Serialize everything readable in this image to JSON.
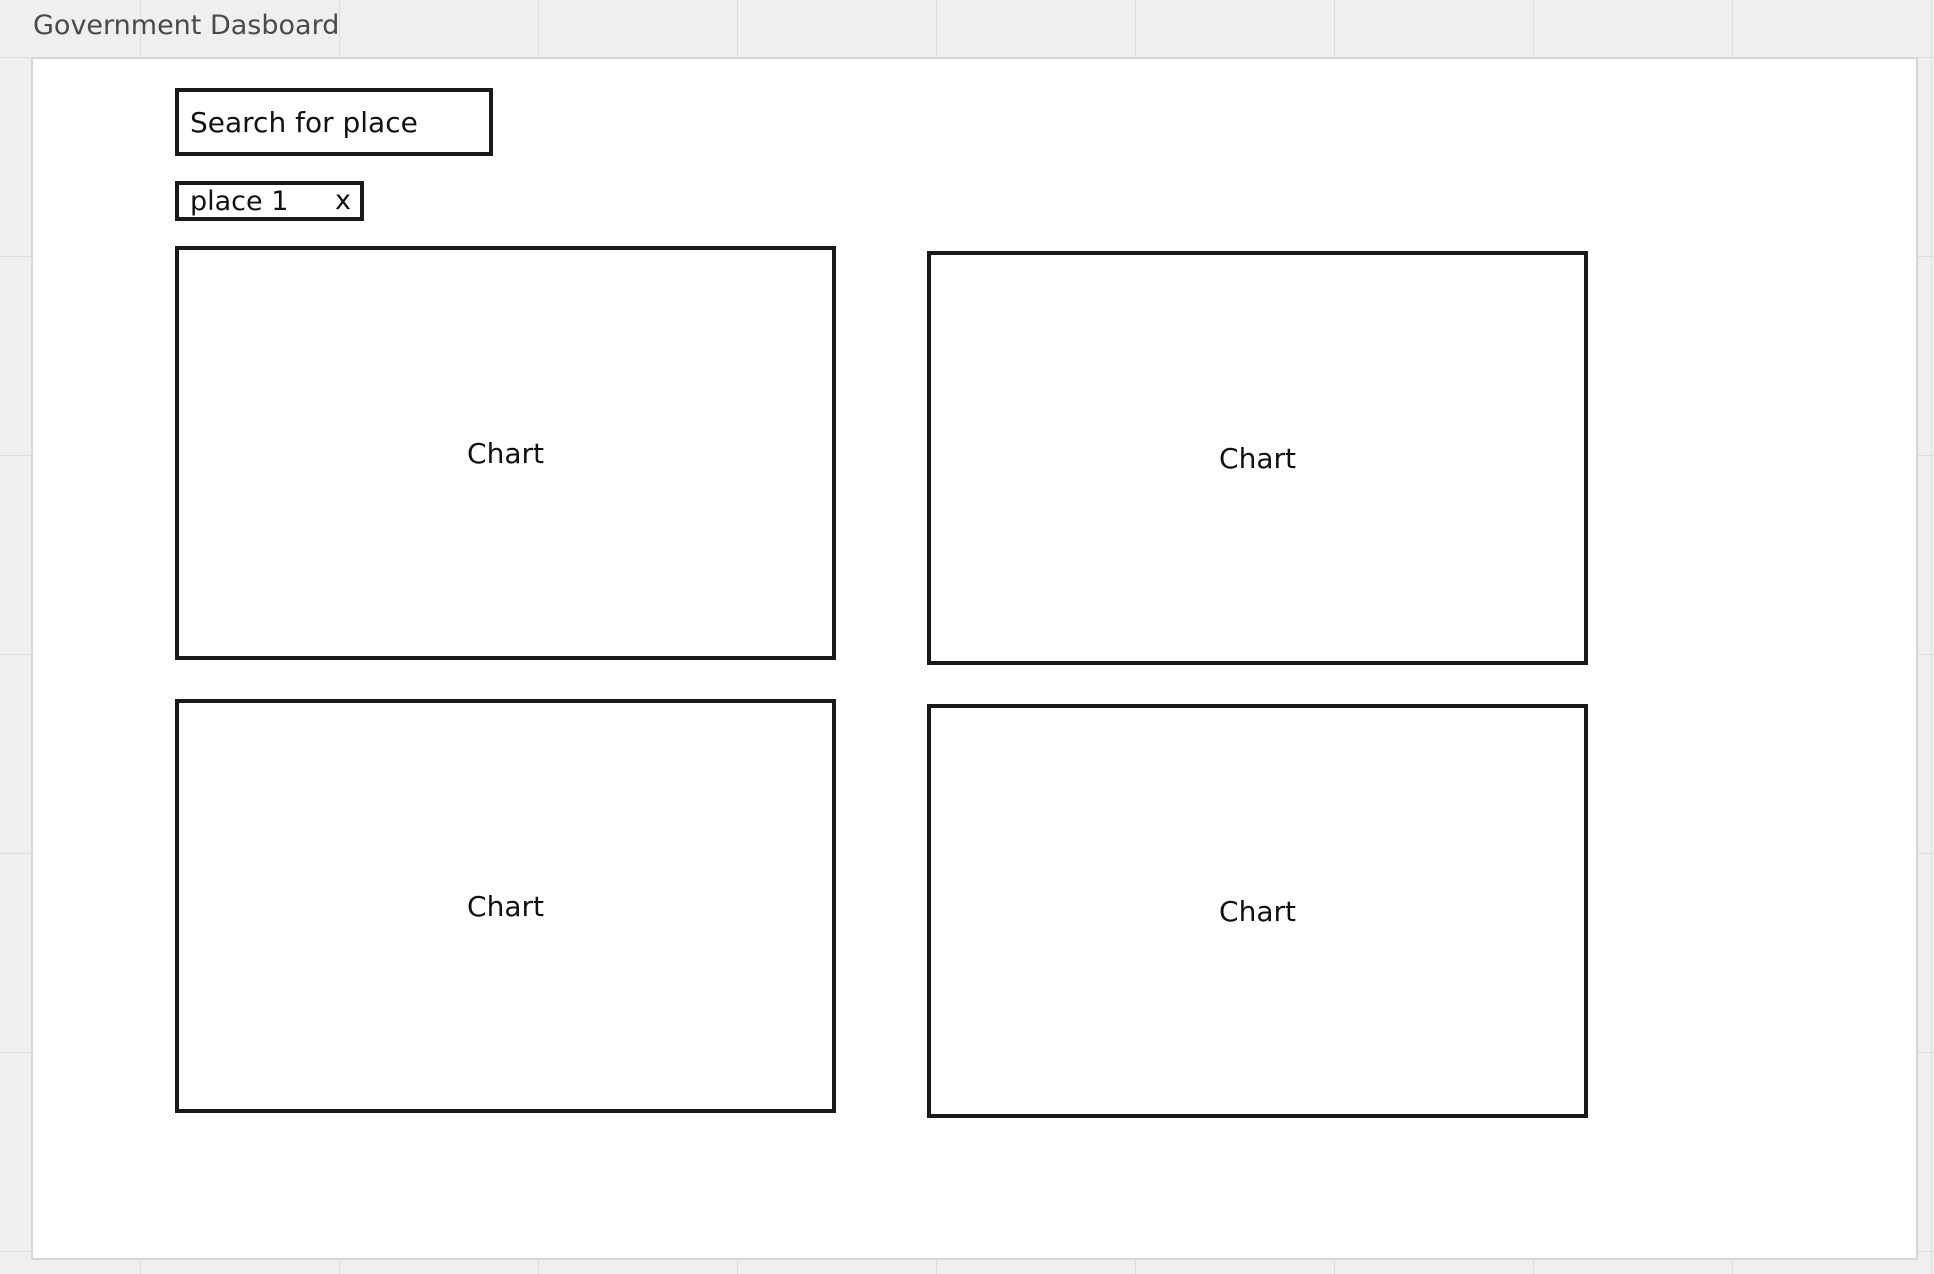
{
  "board": {
    "title": "Government Dasboard"
  },
  "search": {
    "placeholder": "Search for place"
  },
  "selected_places": [
    {
      "label": "place 1",
      "remove_label": "x"
    }
  ],
  "charts": [
    {
      "label": "Chart"
    },
    {
      "label": "Chart"
    },
    {
      "label": "Chart"
    },
    {
      "label": "Chart"
    }
  ],
  "colors": {
    "canvas_background": "#efefef",
    "grid_line": "#dcdcdc",
    "frame_background": "#ffffff",
    "frame_border": "#d6d6d6",
    "wireframe_stroke": "#1a1a1a",
    "title_text": "#4a4a4a"
  },
  "icons": {
    "remove_chip": "close-icon"
  }
}
